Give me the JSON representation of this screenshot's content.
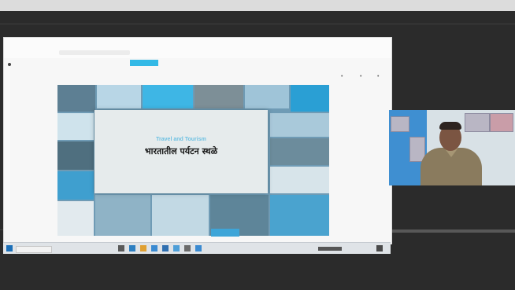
{
  "meeting": {
    "shared_screen": {
      "present_button": "",
      "slide": {
        "subtitle": "Travel and Tourism",
        "title": "भारतातील पर्यटन स्थळे"
      }
    },
    "taskbar": {
      "time": "",
      "date": ""
    },
    "participant": {
      "name": ""
    }
  },
  "colors": {
    "accent": "#33b9e6",
    "taskbar": "#dfe3e7",
    "background": "#2b2b2b"
  }
}
